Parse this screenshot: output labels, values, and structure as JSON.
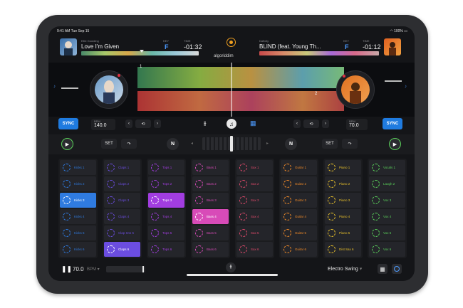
{
  "status": {
    "time": "9:41 AM",
    "date": "Tue Sep 15",
    "battery": "100%"
  },
  "left_deck": {
    "artist": "Ellie Goulding",
    "title": "Love I'm Given",
    "key_label": "KEY",
    "key": "F",
    "time_label": "TIME",
    "time": "-01:32",
    "sync": "SYNC",
    "bpm_label": "BPM",
    "bpm": "140.0",
    "set": "SET",
    "n": "N",
    "cue_number": "1"
  },
  "right_deck": {
    "artist": "Dafixity",
    "title": "BLIND (feat. Young Th...",
    "key_label": "KEY",
    "key": "F",
    "time_label": "TIME",
    "time": "-01:12",
    "sync": "SYNC",
    "bpm_label": "BPM",
    "bpm": "70.0",
    "set": "SET",
    "n": "N",
    "cue_number": "2"
  },
  "brand": "algoriddim",
  "sampler": {
    "columns": [
      {
        "color": "#2f7be0",
        "pads": [
          "Kicks 1",
          "Kicks 2",
          "Kicks 3",
          "Kicks 4",
          "Kicks 5",
          "Kicks 6"
        ],
        "active": 2
      },
      {
        "color": "#6b4de0",
        "pads": [
          "Claps 1",
          "Claps 2",
          "Claps 3",
          "Claps 4",
          "Clap Sns 5",
          "Claps 6"
        ],
        "active": 5
      },
      {
        "color": "#a23de0",
        "pads": [
          "Tops 1",
          "Tops 2",
          "Tops 3",
          "Tops 4",
          "Tops 5",
          "Tops 6"
        ],
        "active": 2
      },
      {
        "color": "#d84bb8",
        "pads": [
          "Bass 1",
          "Bass 2",
          "Bass 3",
          "Bass 4",
          "Bass 5",
          "Bass 6"
        ],
        "active": 3
      },
      {
        "color": "#e04a6b",
        "pads": [
          "Sax 1",
          "Sax 2",
          "Sax 3",
          "Sax 4",
          "Sax 5",
          "Sax 6"
        ],
        "active": -1
      },
      {
        "color": "#f08a28",
        "pads": [
          "Guitar 1",
          "Guitar 2",
          "Guitar 3",
          "Guitar 4",
          "Guitar 5",
          "Guitar 6"
        ],
        "active": -1
      },
      {
        "color": "#e8c02a",
        "pads": [
          "Piano 1",
          "Piano 2",
          "Piano 3",
          "Piano 4",
          "Piano 5",
          "Dist Sax 6"
        ],
        "active": -1
      },
      {
        "color": "#5ad05a",
        "pads": [
          "Vocals 1",
          "Laugh 2",
          "Vox 3",
          "Vox 4",
          "Vox 5",
          "Vox 6"
        ],
        "active": -1
      }
    ]
  },
  "footer": {
    "tempo": "70.0",
    "tempo_unit": "BPM",
    "kit": "Electro Swing"
  },
  "colors": {
    "accent": "#1f7be0",
    "play": "#5ad05a",
    "now_playing": "#f0a020"
  }
}
